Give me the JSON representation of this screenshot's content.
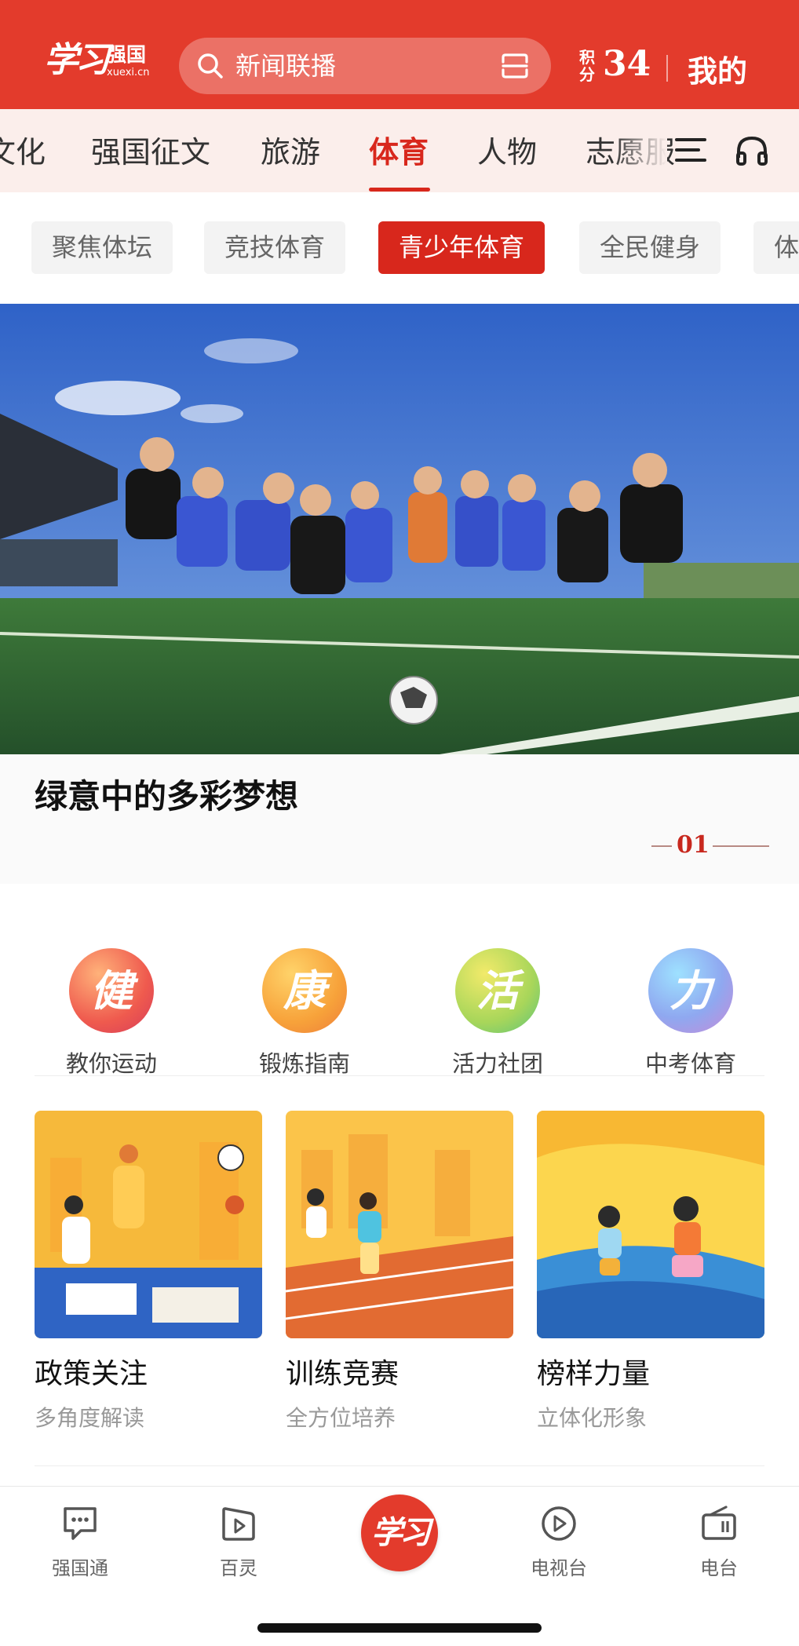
{
  "header": {
    "logo_main": "学习",
    "logo_side": "强国",
    "logo_sub": "xuexi.cn",
    "search_placeholder": "新闻联播",
    "points_label": "积分",
    "points_value": "34",
    "mine_label": "我的"
  },
  "channels": {
    "items": [
      {
        "label": "文化"
      },
      {
        "label": "强国征文"
      },
      {
        "label": "旅游"
      },
      {
        "label": "体育",
        "active": true
      },
      {
        "label": "人物"
      },
      {
        "label": "志愿服"
      }
    ]
  },
  "subtabs": {
    "items": [
      {
        "label": "聚焦体坛"
      },
      {
        "label": "竞技体育"
      },
      {
        "label": "青少年体育",
        "active": true
      },
      {
        "label": "全民健身"
      },
      {
        "label": "体育"
      }
    ]
  },
  "hero": {
    "title": "绿意中的多彩梦想",
    "index": "01"
  },
  "entries": {
    "items": [
      {
        "char": "健",
        "label": "教你运动"
      },
      {
        "char": "康",
        "label": "锻炼指南"
      },
      {
        "char": "活",
        "label": "活力社团"
      },
      {
        "char": "力",
        "label": "中考体育"
      }
    ]
  },
  "cards": {
    "items": [
      {
        "title": "政策关注",
        "subtitle": "多角度解读"
      },
      {
        "title": "训练竞赛",
        "subtitle": "全方位培养"
      },
      {
        "title": "榜样力量",
        "subtitle": "立体化形象"
      }
    ]
  },
  "bottom_nav": {
    "items": [
      {
        "label": "强国通",
        "icon": "chat-icon"
      },
      {
        "label": "百灵",
        "icon": "play-bookmark-icon"
      },
      {
        "label": "学习",
        "icon": "xuexi-logo"
      },
      {
        "label": "电视台",
        "icon": "play-circle-icon"
      },
      {
        "label": "电台",
        "icon": "radio-icon"
      }
    ]
  },
  "colors": {
    "brand_red": "#e33b2c",
    "active_red": "#d8271c",
    "channel_bg": "#fbeeeb"
  }
}
